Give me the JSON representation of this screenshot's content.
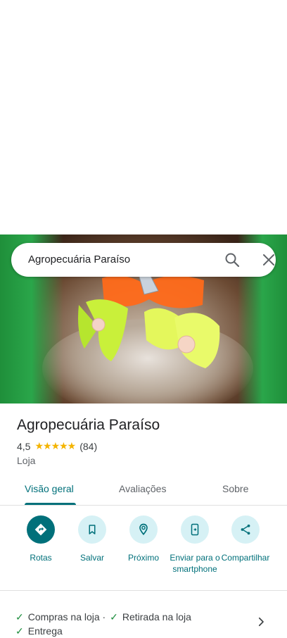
{
  "search": {
    "query": "Agropecuária Paraíso"
  },
  "place": {
    "name": "Agropecuária Paraíso",
    "rating": "4,5",
    "stars": "★★★★★",
    "review_count": "(84)",
    "category": "Loja"
  },
  "tabs": [
    {
      "label": "Visão geral"
    },
    {
      "label": "Avaliações"
    },
    {
      "label": "Sobre"
    }
  ],
  "actions": [
    {
      "label": "Rotas",
      "icon": "directions-icon"
    },
    {
      "label": "Salvar",
      "icon": "bookmark-icon"
    },
    {
      "label": "Próximo",
      "icon": "nearby-icon"
    },
    {
      "label": "Enviar para o smartphone",
      "icon": "send-to-phone-icon"
    },
    {
      "label": "Compartilhar",
      "icon": "share-icon"
    }
  ],
  "features": {
    "item1": "Compras na loja ·",
    "item2": "Retirada na loja",
    "item3": "Entrega"
  },
  "colors": {
    "accent": "#00707a",
    "accent_light": "#d6f1f5",
    "star": "#f4b400",
    "check": "#1e8e3e"
  }
}
